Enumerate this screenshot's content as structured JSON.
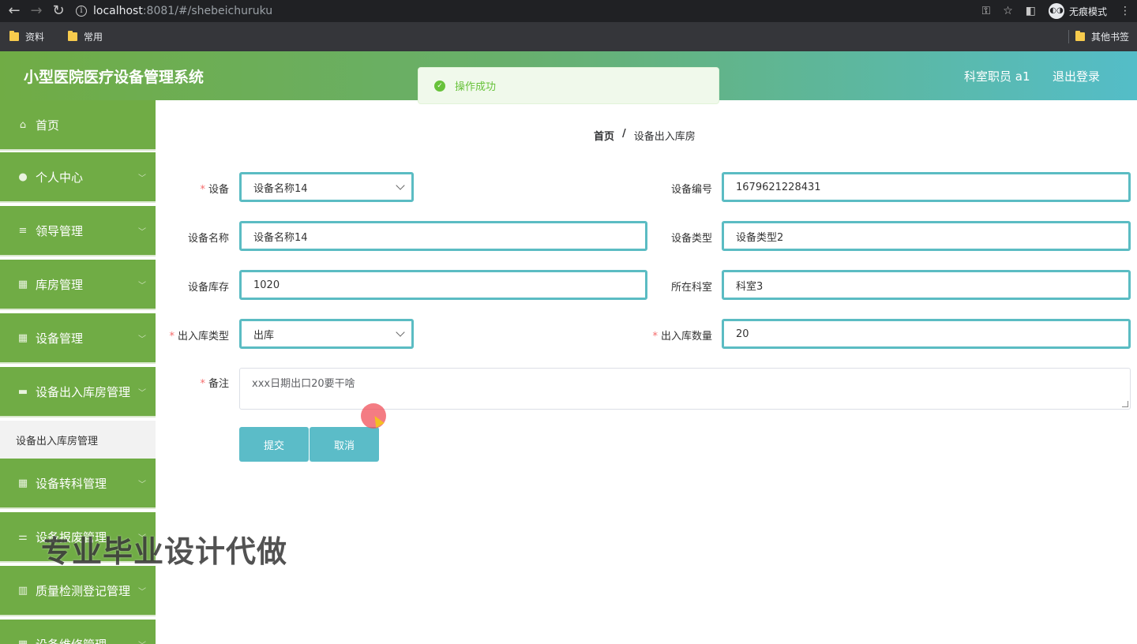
{
  "browser": {
    "url_host": "localhost",
    "url_rest": ":8081/#/shebeichuruku",
    "incognito_label": "无痕模式",
    "bookmarks": [
      "资料",
      "常用"
    ],
    "other_bookmarks": "其他书签"
  },
  "header": {
    "title": "小型医院医疗设备管理系统",
    "user": "科室职员 a1",
    "logout": "退出登录"
  },
  "toast": {
    "message": "操作成功",
    "color": "#67c23a"
  },
  "sidebar": {
    "items": [
      {
        "label": "首页",
        "icon": "home-icon"
      },
      {
        "label": "个人中心",
        "icon": "user-icon"
      },
      {
        "label": "领导管理",
        "icon": "list-icon"
      },
      {
        "label": "库房管理",
        "icon": "grid-icon"
      },
      {
        "label": "设备管理",
        "icon": "grid-icon"
      },
      {
        "label": "设备出入库房管理",
        "icon": "suitcase-icon"
      },
      {
        "label": "设备转科管理",
        "icon": "grid-icon"
      },
      {
        "label": "设备报废管理",
        "icon": "sliders-icon"
      },
      {
        "label": "质量检测登记管理",
        "icon": "chart-icon"
      },
      {
        "label": "设备维修管理",
        "icon": "grid-icon"
      }
    ],
    "submenu_active": "设备出入库房管理"
  },
  "breadcrumb": {
    "home": "首页",
    "separator": "/",
    "current": "设备出入库房"
  },
  "form": {
    "device_label": "设备",
    "device_value": "设备名称14",
    "device_code_label": "设备编号",
    "device_code_value": "1679621228431",
    "device_name_label": "设备名称",
    "device_name_value": "设备名称14",
    "device_type_label": "设备类型",
    "device_type_value": "设备类型2",
    "stock_label": "设备库存",
    "stock_value": "1020",
    "department_label": "所在科室",
    "department_value": "科室3",
    "io_type_label": "出入库类型",
    "io_type_value": "出库",
    "io_qty_label": "出入库数量",
    "io_qty_value": "20",
    "remark_label": "备注",
    "remark_value": "xxx日期出口20要干啥",
    "submit": "提交",
    "cancel": "取消"
  },
  "watermark": "专业毕业设计代做",
  "colors": {
    "sidebar_green": "#70ac45",
    "accent_teal": "#5bbcc8",
    "required_red": "#f56c6c"
  }
}
